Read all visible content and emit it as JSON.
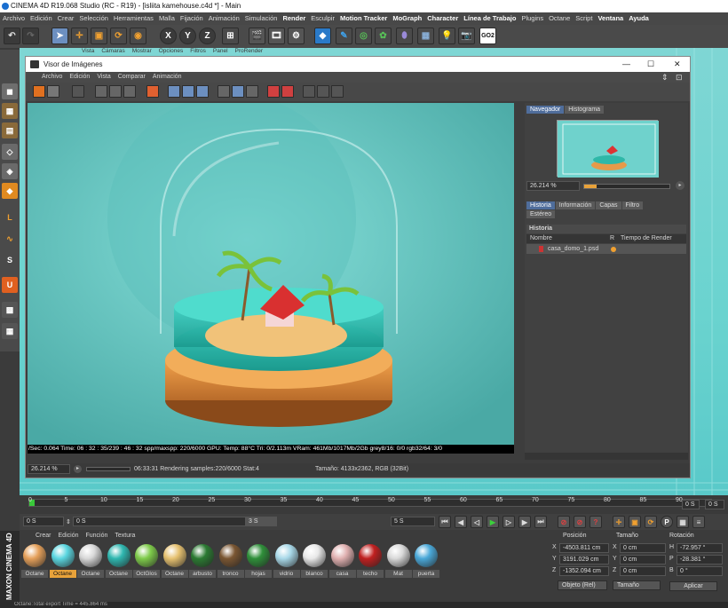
{
  "app": {
    "window_title": "CINEMA 4D R19.068 Studio (RC - R19) - [isliita kamehouse.c4d *] - Main",
    "menu": [
      {
        "label": "Archivo",
        "bold": false
      },
      {
        "label": "Edición",
        "bold": false
      },
      {
        "label": "Crear",
        "bold": false
      },
      {
        "label": "Selección",
        "bold": false
      },
      {
        "label": "Herramientas",
        "bold": false
      },
      {
        "label": "Malla",
        "bold": false
      },
      {
        "label": "Fijación",
        "bold": false
      },
      {
        "label": "Animación",
        "bold": false
      },
      {
        "label": "Simulación",
        "bold": false
      },
      {
        "label": "Render",
        "bold": true
      },
      {
        "label": "Esculpir",
        "bold": false
      },
      {
        "label": "Motion Tracker",
        "bold": true
      },
      {
        "label": "MoGraph",
        "bold": true
      },
      {
        "label": "Character",
        "bold": true
      },
      {
        "label": "Línea de Trabajo",
        "bold": true
      },
      {
        "label": "Plugins",
        "bold": false
      },
      {
        "label": "Octane",
        "bold": false
      },
      {
        "label": "Script",
        "bold": false
      },
      {
        "label": "Ventana",
        "bold": true
      },
      {
        "label": "Ayuda",
        "bold": true
      }
    ],
    "toolbar_icons": [
      "undo-icon",
      "redo-icon",
      "select-icon",
      "move-icon",
      "scale-icon",
      "rotate-icon",
      "recent-icon",
      "axis-x-icon",
      "axis-y-icon",
      "axis-z-icon",
      "coordinate-system-icon",
      "render-view-icon",
      "render-picture-viewer-icon",
      "render-settings-icon",
      "cube-icon",
      "pen-icon",
      "subdivision-icon",
      "array-icon",
      "deformer-icon",
      "floor-icon",
      "light-icon",
      "camera-icon",
      "go-icon"
    ],
    "toolbar_labels": {
      "x": "X",
      "y": "Y",
      "z": "Z",
      "go": "GO2"
    },
    "viewport_menu": [
      "Vista",
      "Cámaras",
      "Mostrar",
      "Opciones",
      "Filtros",
      "Panel",
      "ProRender"
    ]
  },
  "picture_viewer": {
    "title": "Visor de Imágenes",
    "menu": [
      "Archivo",
      "Edición",
      "Vista",
      "Comparar",
      "Animación"
    ],
    "hud": "/Sec: 0.064 Time: 06 : 32 : 35/239 : 46 : 32 spp/maxspp: 220/6000 GPU: Temp: 88°C Tri: 0/2.113m VRam: 461Mb/1017Mb/2Gb grey8/16: 0/0 rgb32/64: 3/0",
    "nav_tabs": [
      "Navegador",
      "Histograma"
    ],
    "nav_zoom": "26.214 %",
    "info_tabs": [
      "Historia",
      "Información",
      "Capas",
      "Filtro",
      "Estéreo"
    ],
    "history_header": "Historia",
    "history_columns": [
      "Nombre",
      "R",
      "Tiempo de Render"
    ],
    "history_rows": [
      {
        "name": "casa_domo_1.psd",
        "status_color": "#f0a030"
      }
    ],
    "status_zoom": "26.214 %",
    "status_render": "06:33:31 Rendering samples:220/6000 Stat:4",
    "status_size": "Tamaño: 4133x2362, RGB (32Bit)"
  },
  "timeline": {
    "ticks": [
      "0",
      "5",
      "10",
      "15",
      "20",
      "25",
      "30",
      "35",
      "40",
      "45",
      "50",
      "55",
      "60",
      "65",
      "70",
      "75",
      "80",
      "85",
      "90"
    ],
    "current_frame": "0 S",
    "start_field": "0 S",
    "range_start": "0 S",
    "range_end": "3 S",
    "end_field": "5 S",
    "right_field": "0 S"
  },
  "materials": {
    "menu": [
      "Crear",
      "Edición",
      "Función",
      "Textura"
    ],
    "items": [
      {
        "label": "Octane",
        "color": "#e5a05a",
        "selected": false
      },
      {
        "label": "Octane",
        "color": "#5ad6e0",
        "selected": true
      },
      {
        "label": "Octane",
        "color": "#d8d8d8",
        "selected": false
      },
      {
        "label": "Octane",
        "color": "#2fb7b0",
        "selected": false
      },
      {
        "label": "OctGlos",
        "color": "#7ecb4a",
        "selected": false
      },
      {
        "label": "Octane",
        "color": "#e6c170",
        "selected": false
      },
      {
        "label": "arbusto",
        "color": "#2b7a32",
        "selected": false
      },
      {
        "label": "tronco",
        "color": "#7a5632",
        "selected": false
      },
      {
        "label": "hojas",
        "color": "#2f8f3a",
        "selected": false
      },
      {
        "label": "vidrio",
        "color": "#a8d8e8",
        "selected": false
      },
      {
        "label": "blanco",
        "color": "#e8e8e8",
        "selected": false
      },
      {
        "label": "casa",
        "color": "#e0b0b0",
        "selected": false
      },
      {
        "label": "techo",
        "color": "#c02020",
        "selected": false
      },
      {
        "label": "Mat",
        "color": "#d9d9d9",
        "selected": false
      },
      {
        "label": "puerta",
        "color": "#4aa8d8",
        "selected": false
      }
    ]
  },
  "coordinates": {
    "headers": [
      "Posición",
      "Tamaño",
      "Rotación"
    ],
    "rows": [
      {
        "axis": "X",
        "pos": "-4503.811 cm",
        "size_axis": "X",
        "size": "0 cm",
        "rot_axis": "H",
        "rot": "-72.957 °"
      },
      {
        "axis": "Y",
        "pos": "3191.029 cm",
        "size_axis": "Y",
        "size": "0 cm",
        "rot_axis": "P",
        "rot": "-28.381 °"
      },
      {
        "axis": "Z",
        "pos": "-1352.094 cm",
        "size_axis": "Z",
        "size": "0 cm",
        "rot_axis": "B",
        "rot": "0 °"
      }
    ],
    "mode_object": "Objeto (Rel)",
    "mode_size": "Tamaño",
    "apply": "Aplicar"
  },
  "status": "Octane:Total export Time = 445.864 ms",
  "maxon_logo": "MAXON CINEMA 4D"
}
